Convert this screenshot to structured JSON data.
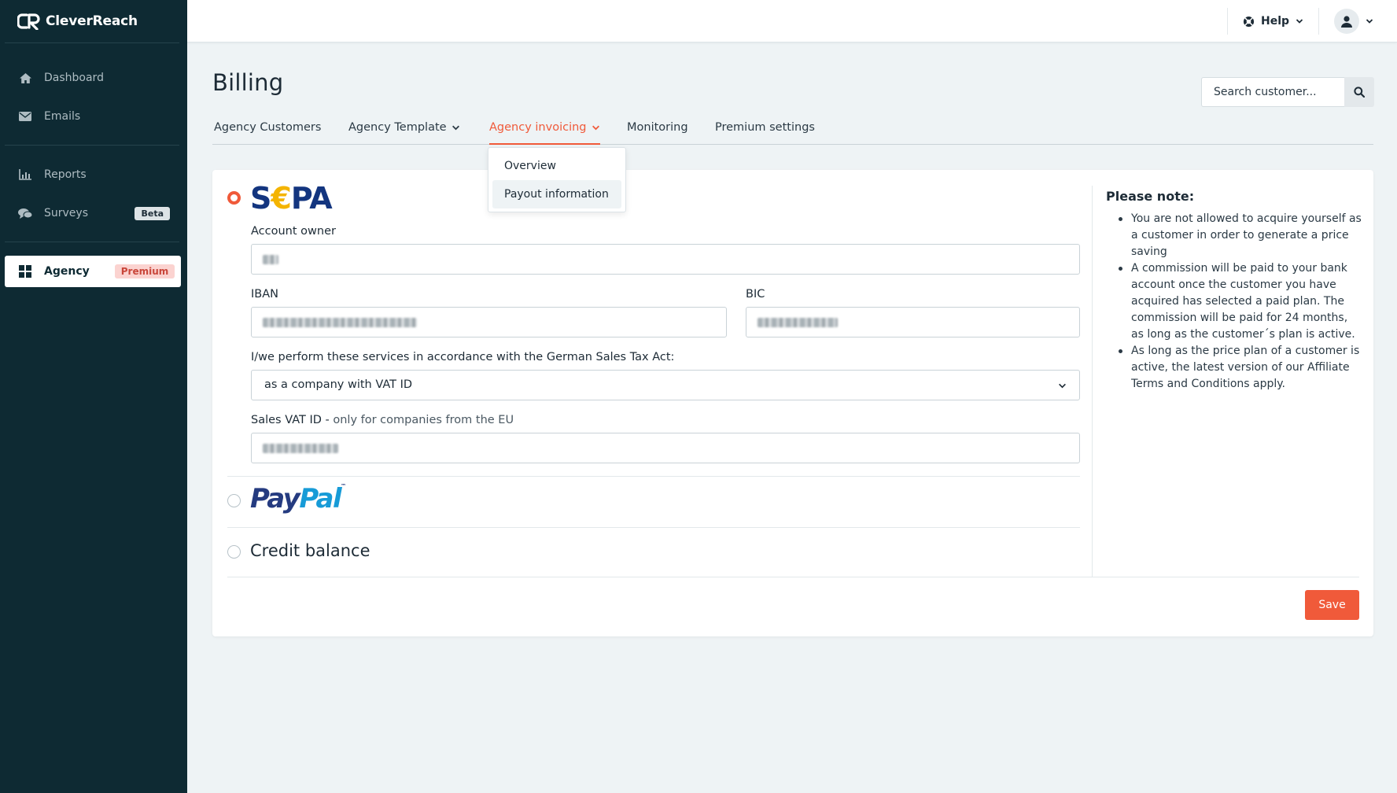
{
  "brand": {
    "name": "CleverReach"
  },
  "sidebar": {
    "items": [
      {
        "label": "Dashboard",
        "icon": "home-icon"
      },
      {
        "label": "Emails",
        "icon": "envelope-icon"
      },
      {
        "label": "Reports",
        "icon": "bar-chart-icon"
      },
      {
        "label": "Surveys",
        "icon": "chat-bubbles-icon",
        "badge": "Beta"
      },
      {
        "label": "Agency",
        "icon": "grid-icon",
        "badge": "Premium",
        "active": true
      }
    ]
  },
  "topbar": {
    "help_label": "Help",
    "help_icon": "lifebuoy-icon",
    "user_icon": "user-icon"
  },
  "page": {
    "title": "Billing",
    "search_placeholder": "Search customer..."
  },
  "tabs": [
    {
      "label": "Agency Customers"
    },
    {
      "label": "Agency Template",
      "has_dropdown": true
    },
    {
      "label": "Agency invoicing",
      "has_dropdown": true,
      "active": true
    },
    {
      "label": "Monitoring"
    },
    {
      "label": "Premium settings"
    }
  ],
  "dropdown": {
    "items": [
      "Overview",
      "Payout information"
    ],
    "highlighted": "Payout information"
  },
  "payment": {
    "sepa": {
      "logo_text": "S€PA",
      "selected": true,
      "account_owner_label": "Account owner",
      "iban_label": "IBAN",
      "bic_label": "BIC",
      "tax_act_label": "I/we perform these services in accordance with the German Sales Tax Act:",
      "tax_act_value": "as a company with VAT ID",
      "vat_label_main": "Sales VAT ID - ",
      "vat_label_muted": "only for companies from the EU"
    },
    "paypal": {
      "logo_pay": "Pay",
      "logo_pal": "Pal",
      "tm": "™",
      "selected": false
    },
    "credit": {
      "label": "Credit balance",
      "selected": false
    }
  },
  "note": {
    "title": "Please note:",
    "items": [
      "You are not allowed to acquire yourself as a customer in order to generate a price saving",
      "A commission will be paid to your bank account once the customer you have acquired has selected a paid plan. The commission will be paid for 24 months, as long as the customer´s plan is active.",
      "As long as the price plan of a customer is active, the latest version of our Affiliate Terms and Conditions apply."
    ]
  },
  "actions": {
    "save_label": "Save"
  },
  "colors": {
    "accent": "#f05a3a",
    "sidebar_bg": "#0e2a33",
    "sepa_blue": "#13357f",
    "sepa_yellow": "#f4b400",
    "paypal_dark": "#253b80",
    "paypal_light": "#179bd7"
  }
}
